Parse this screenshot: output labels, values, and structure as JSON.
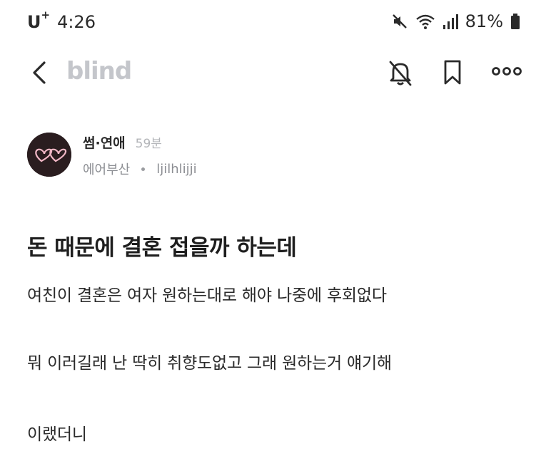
{
  "status_bar": {
    "carrier": "U",
    "carrier_plus": "+",
    "time": "4:26",
    "battery": "81%",
    "icons": [
      "mute-icon",
      "wifi-icon",
      "signal-icon",
      "battery-icon"
    ]
  },
  "nav": {
    "logo": "blind",
    "icons": [
      "back-icon",
      "bell-off-icon",
      "bookmark-icon",
      "more-icon"
    ]
  },
  "post": {
    "channel": "썸·연애",
    "time_ago": "59분",
    "company": "에어부산",
    "username": "ljilhlijji",
    "title": "돈 때문에 결혼 접을까 하는데",
    "body": [
      "여친이 결혼은 여자 원하는대로 해야 나중에 후회없다",
      "뭐 이러길래 난 딱히 취향도없고 그래 원하는거 얘기해",
      "이랬더니"
    ]
  },
  "colors": {
    "logo": "#c4c6cb",
    "avatar_bg": "#2a1d1f",
    "avatar_heart": "#f2b8c6",
    "muted_text": "#8c8e93"
  }
}
